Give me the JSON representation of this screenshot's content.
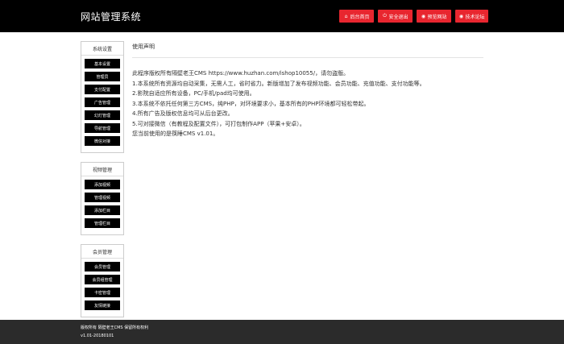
{
  "header": {
    "title": "网站管理系统",
    "buttons": [
      {
        "icon": "home-icon",
        "glyph": "⌂",
        "label": "后台首页",
        "color": "#e8262f"
      },
      {
        "icon": "power-icon",
        "glyph": "⏻",
        "label": "安全退出",
        "color": "#e8262f"
      },
      {
        "icon": "eye-icon",
        "glyph": "◉",
        "label": "预览网站",
        "color": "#e8262f"
      },
      {
        "icon": "eye-icon",
        "glyph": "◉",
        "label": "技术论坛",
        "color": "#e8262f"
      }
    ]
  },
  "sidebar": {
    "groups": [
      {
        "title": "系统设置",
        "items": [
          "基本设置",
          "管理员",
          "支付配置",
          "广告管理",
          "幻灯管理",
          "导航管理",
          "微信对接"
        ]
      },
      {
        "title": "视频管理",
        "items": [
          "添加视频",
          "管理视频",
          "添加栏目",
          "管理栏目"
        ]
      },
      {
        "title": "会员管理",
        "items": [
          "会员管理",
          "会员组管理",
          "卡密管理",
          "友情链接"
        ]
      }
    ]
  },
  "main": {
    "title": "使用声明",
    "lines": [
      "此程序版权所有隔壁老王CMS https://www.huzhan.com/ishop10055/，请勿盗版。",
      "1.本系统所有资源均自动采集，无需人工，省时省力。新版增加了发布视频功能、会员功能、充值功能、支付功能等。",
      "2.影院自适应所有设备，PC/手机/pad均可使用。",
      "3.本系统不依托任何第三方CMS，纯PHP，对环境要求小，基本所有的PHP环境都可轻松带起。",
      "4.所有广告及版权信息均可从后台更改。",
      "5.可对接微信（有教程及配置文件），可打包制作APP（苹果+安卓）。",
      "您当前使用的是筷睡CMS v1.01。"
    ]
  },
  "footer": {
    "copyright": "版权所有 隔壁老王CMS 保留所有权利",
    "version": "v1.01-20180101"
  }
}
